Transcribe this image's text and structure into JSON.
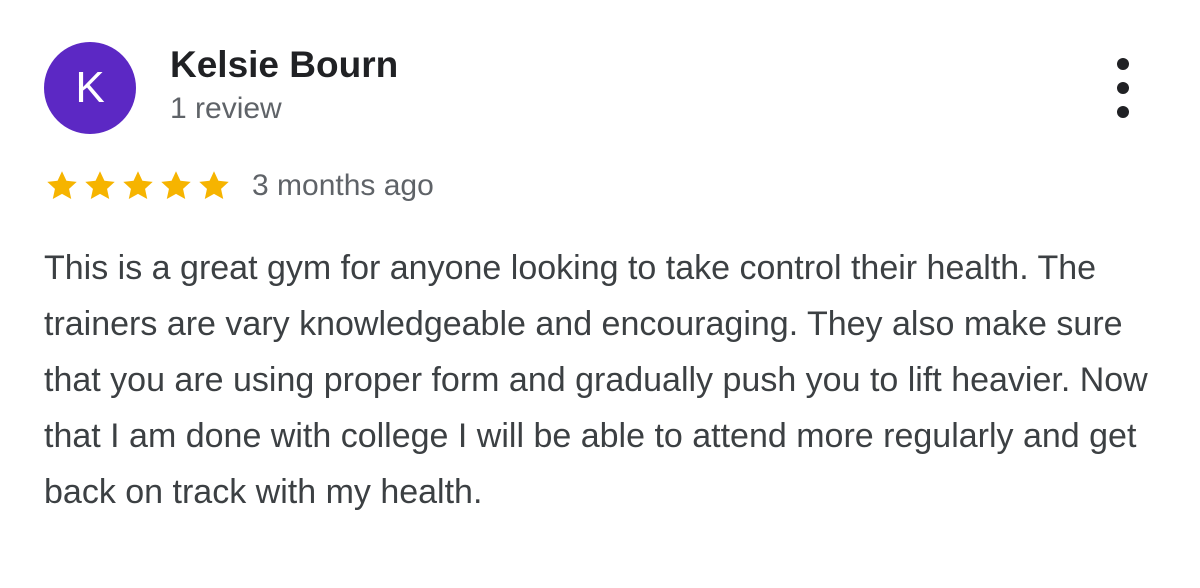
{
  "review": {
    "avatar_initial": "K",
    "avatar_color": "#5c28c4",
    "reviewer_name": "Kelsie Bourn",
    "review_count": "1 review",
    "rating": 5,
    "rating_max": 5,
    "star_color": "#f6b400",
    "date": "3 months ago",
    "text": "This is a great gym for anyone looking to take control their health. The trainers are vary knowledgeable and encouraging. They also make sure that you are using proper form and gradually push you to lift heavier. Now that I am done with college I will be able to attend more regularly and get back on track with my health.",
    "more_icon": "more-vert-icon"
  }
}
